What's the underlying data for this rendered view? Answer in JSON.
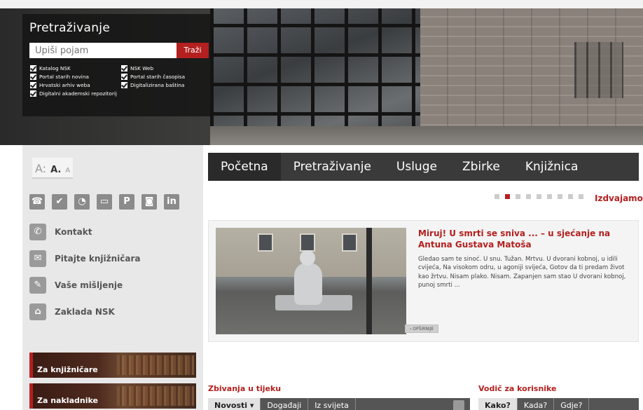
{
  "search": {
    "title": "Pretraživanje",
    "placeholder": "Upiši pojam",
    "button_label": "Traži",
    "options": [
      {
        "label": "Katalog NSK",
        "checked": true
      },
      {
        "label": "NSK Web",
        "checked": true
      },
      {
        "label": "Portal starih novina",
        "checked": true
      },
      {
        "label": "Portal starih časopisa",
        "checked": true
      },
      {
        "label": "Hrvatski arhiv weba",
        "checked": true
      },
      {
        "label": "Digitalizirana baština",
        "checked": true
      },
      {
        "label": "Digitalni akademski repozitorij",
        "checked": true
      }
    ]
  },
  "font_sizes": {
    "large": "A:",
    "medium": "A.",
    "small": "A"
  },
  "social_icons": [
    "contact-card-icon",
    "twitter-icon",
    "rss-icon",
    "tv-icon",
    "pinterest-icon",
    "feed-icon",
    "linkedin-icon"
  ],
  "sidebar": {
    "links": [
      {
        "label": "Kontakt",
        "icon": "phone-icon"
      },
      {
        "label": "Pitajte knjižničara",
        "icon": "chat-icon"
      },
      {
        "label": "Vaše mišljenje",
        "icon": "pencil-icon"
      },
      {
        "label": "Zaklada NSK",
        "icon": "building-icon"
      }
    ],
    "banners": [
      {
        "label": "Za knjižničare"
      },
      {
        "label": "Za nakladnike"
      }
    ]
  },
  "nav": {
    "items": [
      "Početna",
      "Pretraživanje",
      "Usluge",
      "Zbirke",
      "Knjižnica"
    ],
    "active_index": 0
  },
  "slider": {
    "label": "Izdvajamo",
    "total": 9,
    "active_index": 1
  },
  "article": {
    "title": "Miruj! U smrti se sniva ... – u sjećanje na Antuna Gustava Matoša",
    "text": "Gledao sam te sinoć. U snu. Tužan. Mrtvu. U dvorani kobnoj, u idili cvijeća, Na visokom odru, u agoniji svijeća, Gotov da ti predam život kao žrtvu. Nisam plako. Nisam. Zapanjen sam stao U dvorani kobnoj, punoj smrti ...",
    "more_label": "› OPŠIRNIJE"
  },
  "news": {
    "title": "Zbivanja u tijeku",
    "tabs": [
      "Novosti ▾",
      "Događaji",
      "Iz svijeta"
    ],
    "active_index": 0
  },
  "guide": {
    "title": "Vodič za korisnike",
    "tabs": [
      "Kako?",
      "Kada?",
      "Gdje?"
    ],
    "active_index": 0
  },
  "colors": {
    "accent": "#b3201f",
    "nav_bg": "#3a3a3a",
    "sidebar_bg": "#e8e8e8"
  }
}
